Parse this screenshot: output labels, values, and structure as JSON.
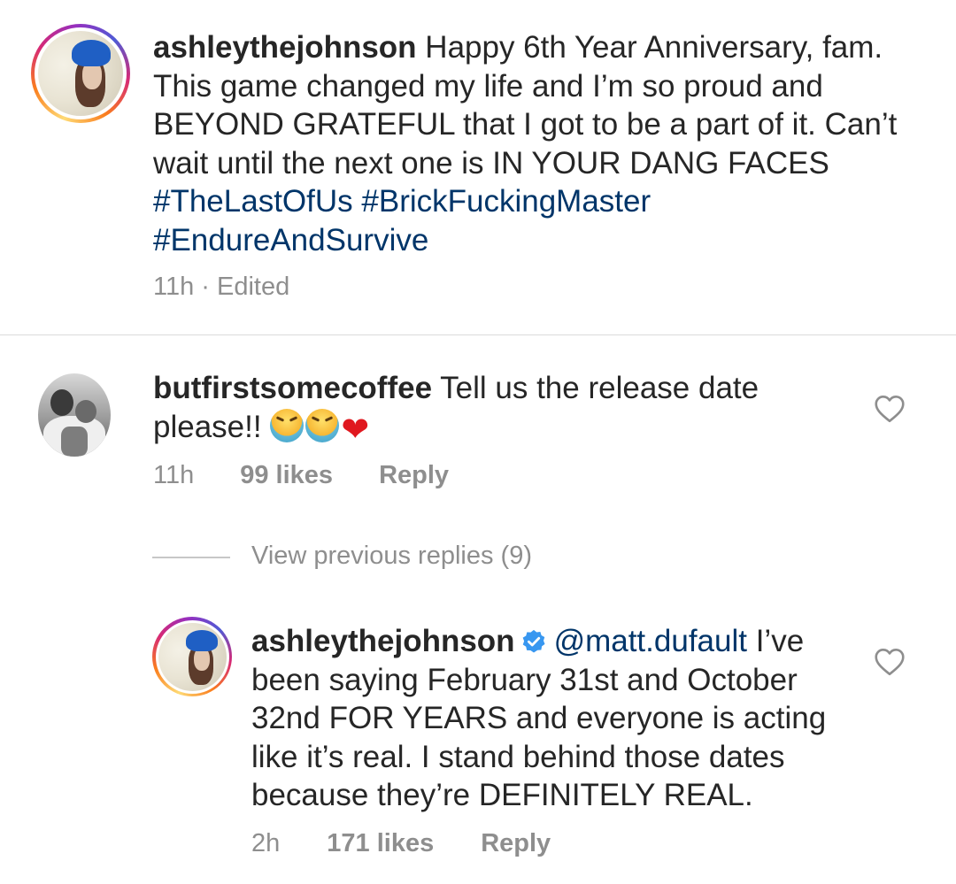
{
  "caption": {
    "username": "ashleythejohnson",
    "text": " Happy 6th Year Anniversary, fam. This game changed my life and I’m so proud and BEYOND GRATEFUL that I got to be a part of it. Can’t wait until the next one is IN YOUR DANG FACES ",
    "hashtags": [
      "#TheLastOfUs",
      "#BrickFuckingMaster",
      "#EndureAndSurvive"
    ],
    "meta": "11h · Edited"
  },
  "comment": {
    "username": "butfirstsomecoffee",
    "text": " Tell us the release date please!! ",
    "emojis": [
      "tired-face-emoji",
      "tired-face-emoji",
      "red-heart-emoji"
    ],
    "time": "11h",
    "likes": "99 likes",
    "reply_label": "Reply"
  },
  "view_previous_replies": "View previous replies (9)",
  "reply": {
    "username": "ashleythejohnson",
    "verified": true,
    "mention": "@matt.dufault",
    "text": " I’ve been saying February 31st and October 32nd FOR YEARS and everyone is acting like it’s real. I stand behind those dates because they’re DEFINITELY REAL.",
    "time": "2h",
    "likes": "171 likes",
    "reply_label": "Reply"
  },
  "colors": {
    "text": "#262626",
    "muted": "#8e8e8e",
    "link": "#003569",
    "verified": "#3897f0",
    "divider": "#dbdbdb"
  }
}
